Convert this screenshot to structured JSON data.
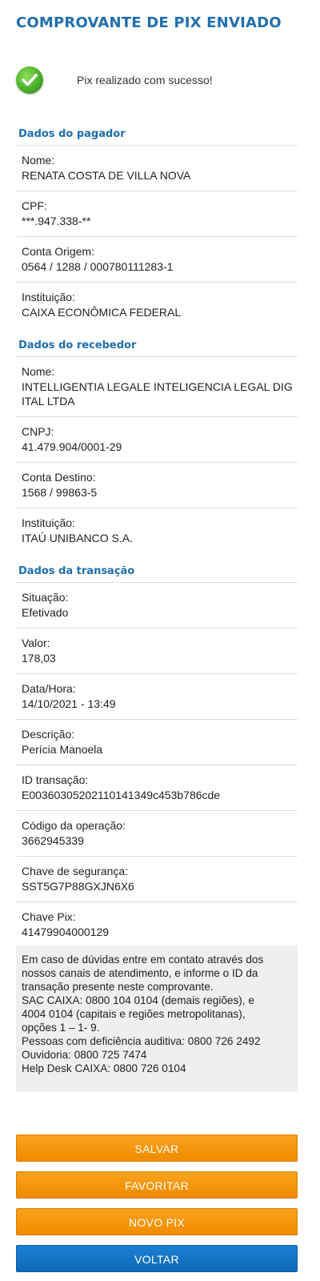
{
  "header": {
    "title": "COMPROVANTE DE PIX ENVIADO"
  },
  "status": {
    "icon": "check-circle-icon",
    "icon_color": "#4caf2a",
    "message": "Pix realizado com sucesso!"
  },
  "payer": {
    "title": "Dados do pagador",
    "fields": [
      {
        "label": "Nome:",
        "value": "RENATA COSTA DE VILLA NOVA"
      },
      {
        "label": "CPF:",
        "value": "***.947.338-**"
      },
      {
        "label": "Conta Origem:",
        "value": "0564 / 1288 / 000780111283-1"
      },
      {
        "label": "Instituição:",
        "value": "CAIXA ECONÔMICA FEDERAL"
      }
    ]
  },
  "receiver": {
    "title": "Dados do recebedor",
    "fields": [
      {
        "label": "Nome:",
        "value": "INTELLIGENTIA LEGALE INTELIGENCIA LEGAL DIGITAL LTDA"
      },
      {
        "label": "CNPJ:",
        "value": "41.479.904/0001-29"
      },
      {
        "label": "Conta Destino:",
        "value": "1568 / 99863-5"
      },
      {
        "label": "Instituição:",
        "value": "ITAÚ UNIBANCO S.A."
      }
    ]
  },
  "transaction": {
    "title": "Dados da transação",
    "fields": [
      {
        "label": "Situação:",
        "value": "Efetivado"
      },
      {
        "label": "Valor:",
        "value": "178,03"
      },
      {
        "label": "Data/Hora:",
        "value": "14/10/2021 - 13:49"
      },
      {
        "label": "Descrição:",
        "value": "Perícia Manoela"
      },
      {
        "label": "ID transação:",
        "value": "E00360305202110141349c453b786cde"
      },
      {
        "label": "Código da operação:",
        "value": "3662945339"
      },
      {
        "label": "Chave de segurança:",
        "value": "SST5G7P88GXJN6X6"
      },
      {
        "label": "Chave Pix:",
        "value": "41479904000129"
      }
    ]
  },
  "info": {
    "lines": [
      "Em caso de dúvidas entre em contato através dos",
      "nossos canais de atendimento, e informe o ID da",
      "transação presente neste comprovante.",
      "SAC CAIXA: 0800 104 0104 (demais regiões), e",
      "4004 0104 (capitais e regiões metropolitanas),",
      "opções 1 – 1- 9.",
      "Pessoas com deficiência auditiva: 0800 726 2492",
      "Ouvidoria: 0800 725 7474",
      "Help Desk CAIXA: 0800 726 0104"
    ]
  },
  "actions": {
    "save": "SALVAR",
    "favorite": "FAVORITAR",
    "new_pix": "NOVO PIX",
    "back": "VOLTAR"
  },
  "colors": {
    "title_blue": "#1f6fae",
    "button_orange": "#f39200",
    "button_blue": "#1676c8"
  }
}
